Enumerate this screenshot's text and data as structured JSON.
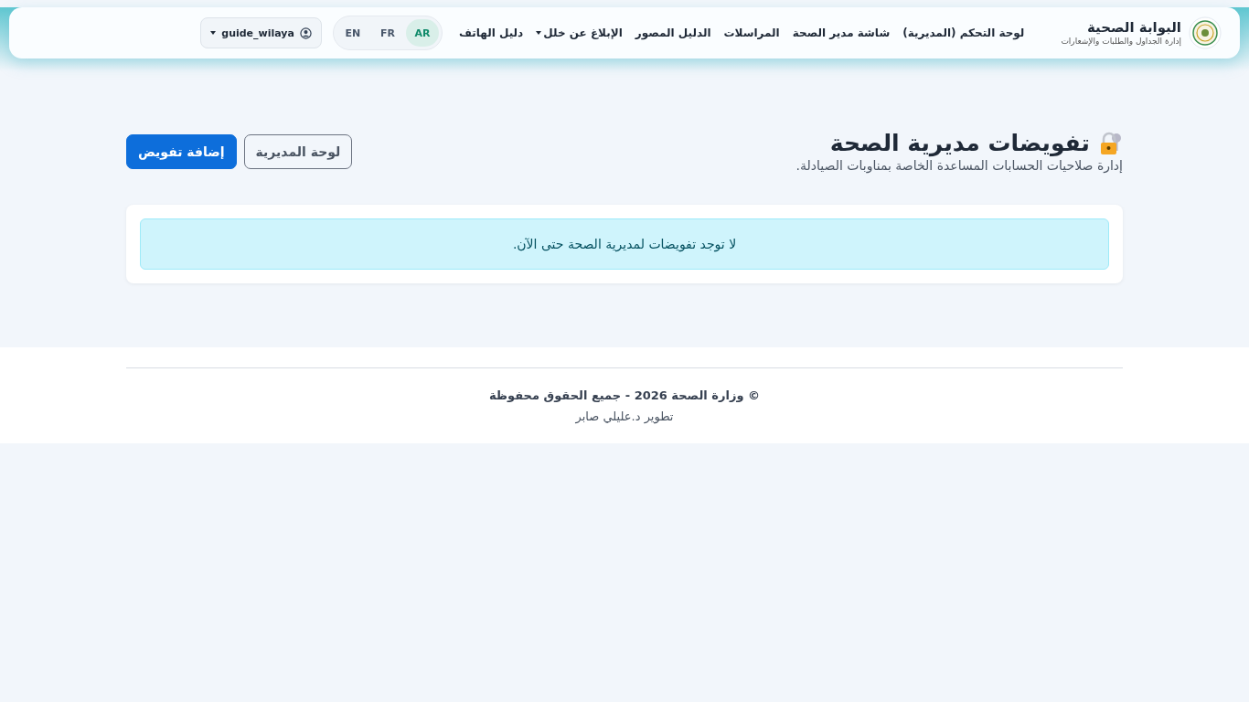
{
  "brand": {
    "title": "البوابة الصحية",
    "subtitle": "إدارة الجداول والطلبات والإشعارات"
  },
  "nav": [
    {
      "label": "لوحة التحكم (المديرية)",
      "kind": "link"
    },
    {
      "label": "شاشة مدير الصحة",
      "kind": "link"
    },
    {
      "label": "المراسلات",
      "kind": "link"
    },
    {
      "label": "الدليل المصور",
      "kind": "link"
    },
    {
      "label": "الإبلاغ عن خلل",
      "kind": "dropdown"
    },
    {
      "label": "دليل الهاتف",
      "kind": "link"
    }
  ],
  "languages": [
    {
      "label": "AR",
      "selected": true
    },
    {
      "label": "FR",
      "selected": false
    },
    {
      "label": "EN",
      "selected": false
    }
  ],
  "user": {
    "name": "guide_wilaya"
  },
  "page": {
    "title": "تفويضات مديرية الصحة",
    "subtitle": "إدارة صلاحيات الحسابات المساعدة الخاصة بمناوبات الصيادلة.",
    "buttons": [
      {
        "label": "لوحة المديرية",
        "kind": "outline"
      },
      {
        "label": "إضافة تفويض",
        "kind": "primary"
      }
    ]
  },
  "alert": {
    "text": "لا توجد تفويضات لمديرية الصحة حتى الآن."
  },
  "footer": {
    "copyright": "© وزارة الصحة 2026 - جميع الحقوق محفوظة",
    "credit": "تطوير د.عليلي صابر"
  }
}
